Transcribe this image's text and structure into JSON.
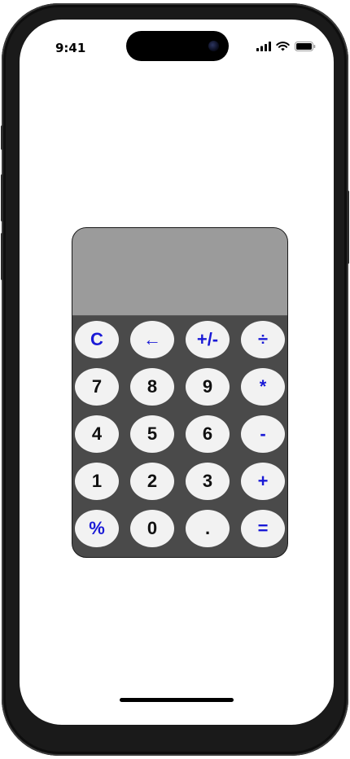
{
  "status_bar": {
    "time": "9:41"
  },
  "display": {
    "value": ""
  },
  "keys": [
    {
      "name": "clear-button",
      "label": "C",
      "kind": "op"
    },
    {
      "name": "backspace-button",
      "label": "←",
      "kind": "op"
    },
    {
      "name": "toggle-sign-button",
      "label": "+/-",
      "kind": "op"
    },
    {
      "name": "divide-button",
      "label": "÷",
      "kind": "op"
    },
    {
      "name": "digit-7-button",
      "label": "7",
      "kind": "digit"
    },
    {
      "name": "digit-8-button",
      "label": "8",
      "kind": "digit"
    },
    {
      "name": "digit-9-button",
      "label": "9",
      "kind": "digit"
    },
    {
      "name": "multiply-button",
      "label": "*",
      "kind": "op"
    },
    {
      "name": "digit-4-button",
      "label": "4",
      "kind": "digit"
    },
    {
      "name": "digit-5-button",
      "label": "5",
      "kind": "digit"
    },
    {
      "name": "digit-6-button",
      "label": "6",
      "kind": "digit"
    },
    {
      "name": "subtract-button",
      "label": "-",
      "kind": "op"
    },
    {
      "name": "digit-1-button",
      "label": "1",
      "kind": "digit"
    },
    {
      "name": "digit-2-button",
      "label": "2",
      "kind": "digit"
    },
    {
      "name": "digit-3-button",
      "label": "3",
      "kind": "digit"
    },
    {
      "name": "add-button",
      "label": "+",
      "kind": "op"
    },
    {
      "name": "percent-button",
      "label": "%",
      "kind": "op"
    },
    {
      "name": "digit-0-button",
      "label": "0",
      "kind": "digit"
    },
    {
      "name": "decimal-button",
      "label": ".",
      "kind": "digit"
    },
    {
      "name": "equals-button",
      "label": "=",
      "kind": "op"
    }
  ],
  "colors": {
    "operator_text": "#1a1ad6",
    "digit_text": "#111111",
    "key_background": "#f2f2f2",
    "keypad_background": "#4a4a4a",
    "display_background": "#9b9b9b"
  },
  "icons": [
    "signal-icon",
    "wifi-icon",
    "battery-icon",
    "camera-icon"
  ]
}
